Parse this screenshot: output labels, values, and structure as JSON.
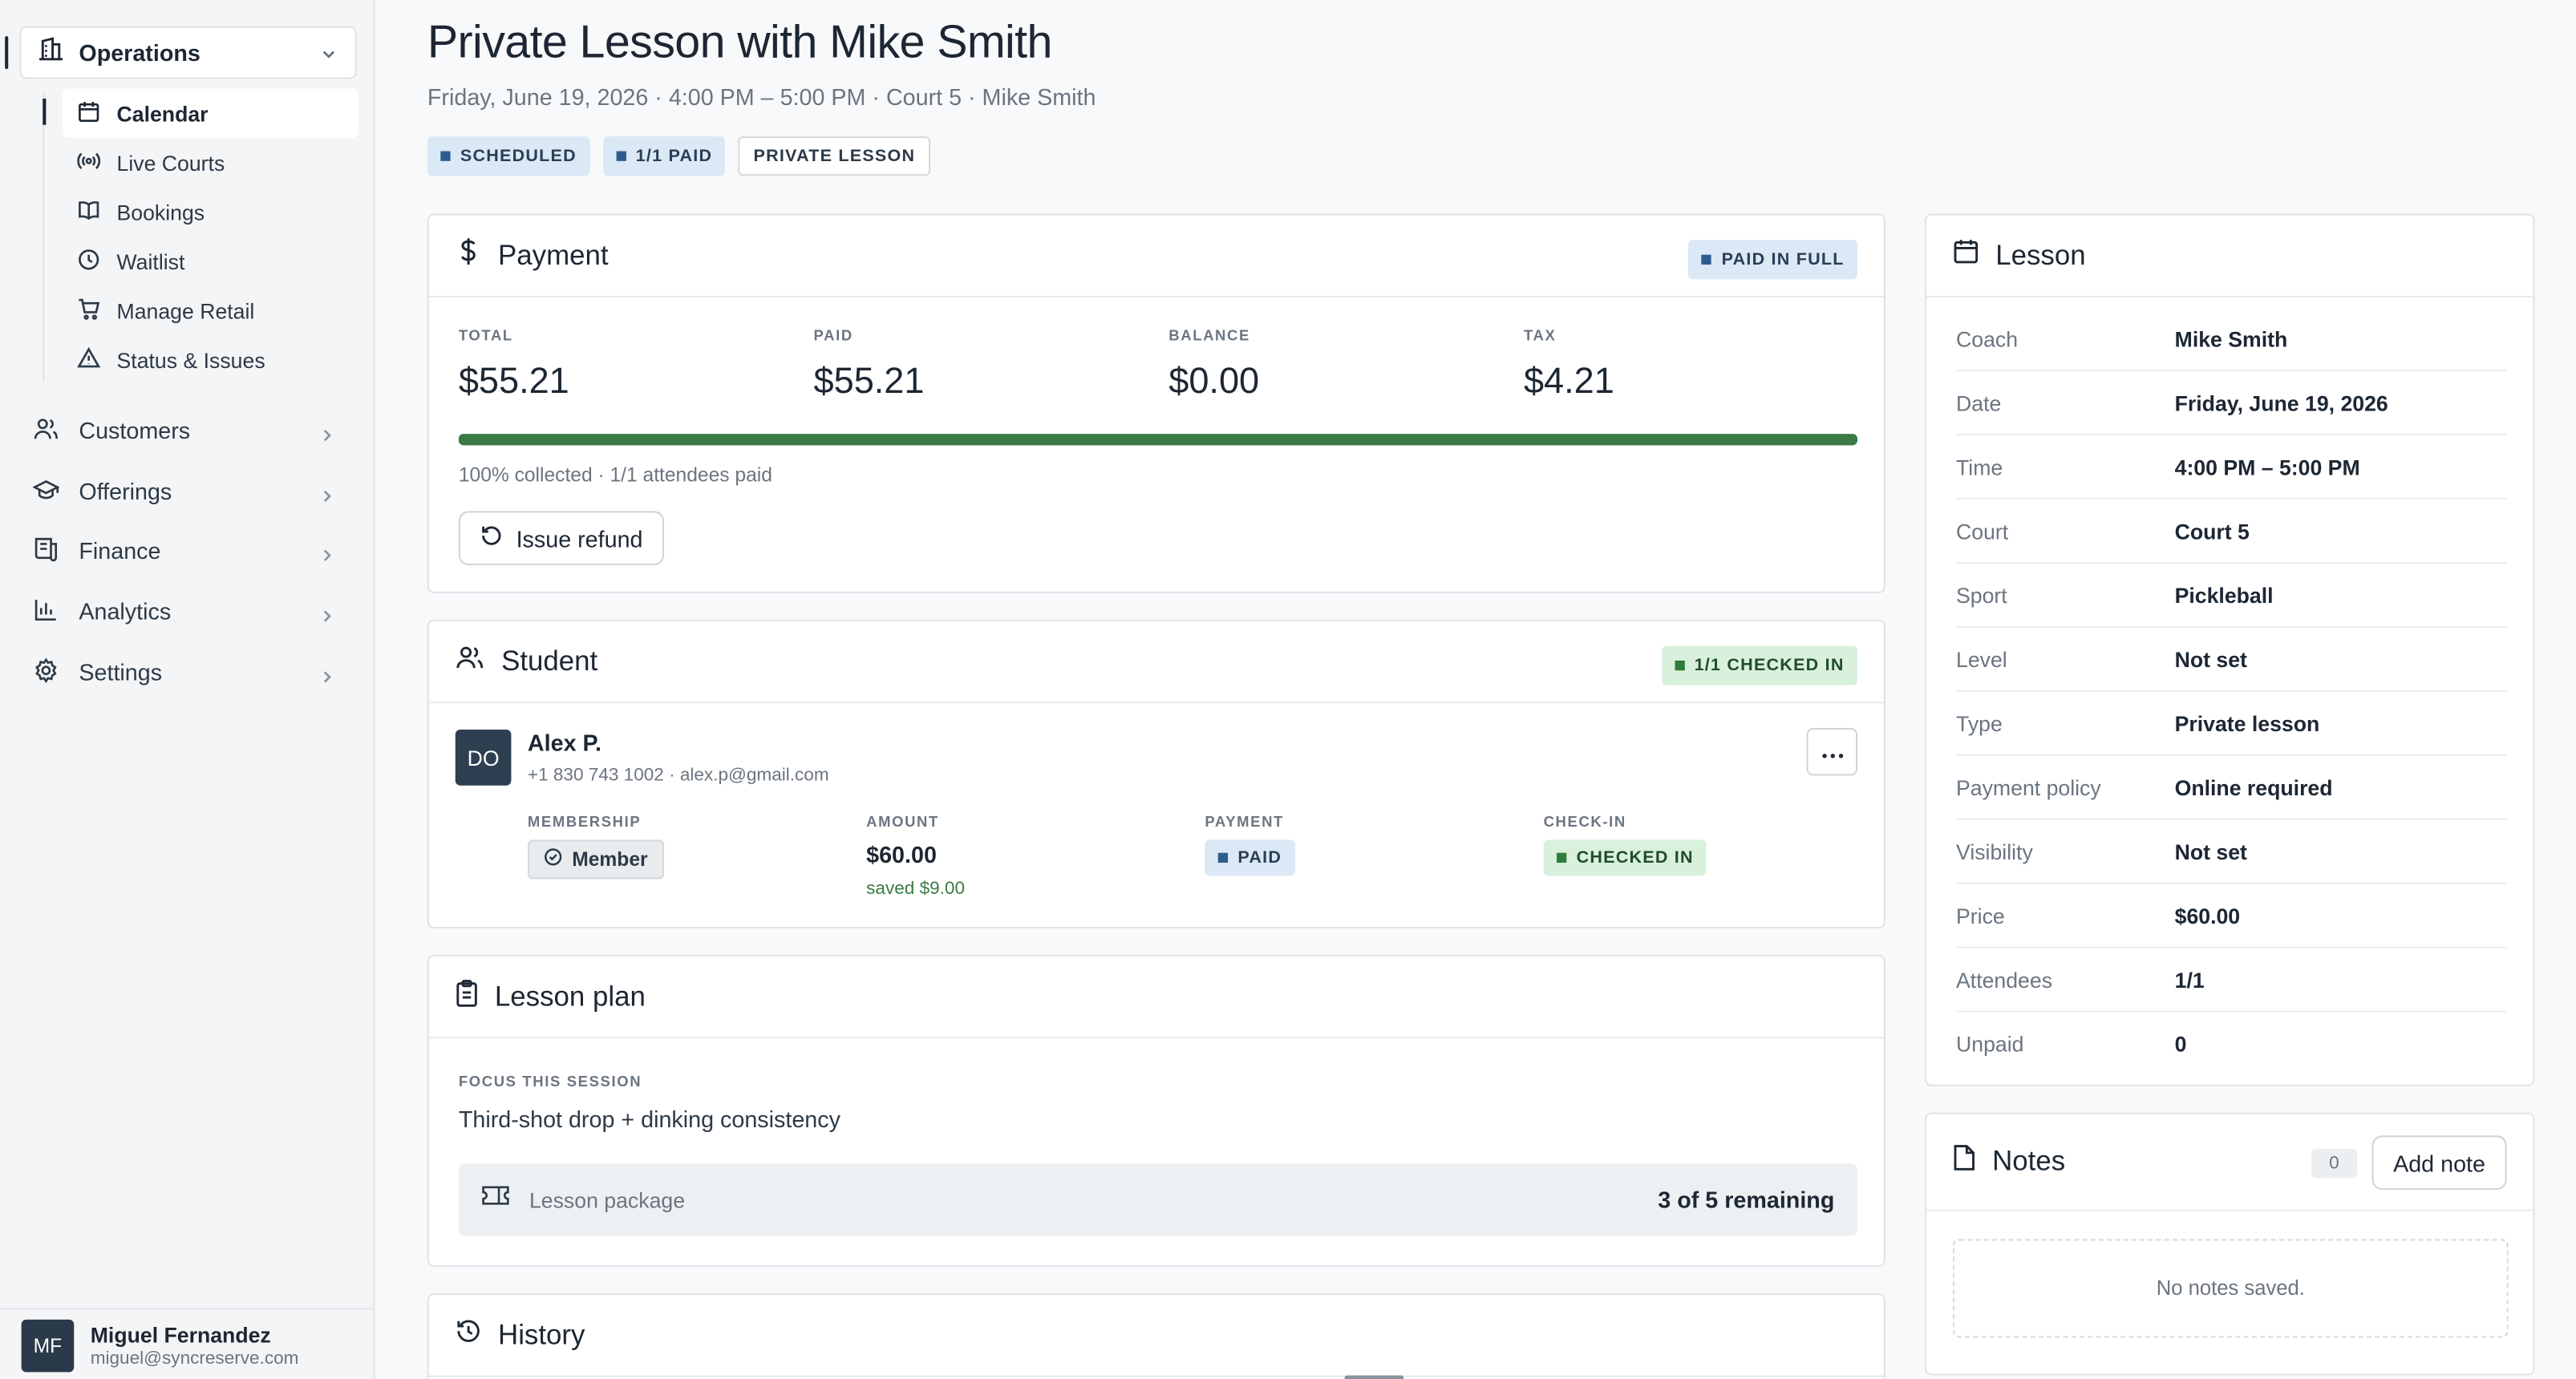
{
  "sidebar": {
    "operations": {
      "label": "Operations"
    },
    "sub_items": [
      {
        "label": "Calendar",
        "icon": "calendar-icon",
        "active": true
      },
      {
        "label": "Live Courts",
        "icon": "broadcast-icon"
      },
      {
        "label": "Bookings",
        "icon": "book-icon"
      },
      {
        "label": "Waitlist",
        "icon": "clock-icon"
      },
      {
        "label": "Manage Retail",
        "icon": "cart-icon"
      },
      {
        "label": "Status & Issues",
        "icon": "warning-icon"
      }
    ],
    "groups": [
      {
        "label": "Customers",
        "icon": "users-icon"
      },
      {
        "label": "Offerings",
        "icon": "graduation-cap-icon"
      },
      {
        "label": "Finance",
        "icon": "ledger-icon"
      },
      {
        "label": "Analytics",
        "icon": "bar-chart-icon"
      },
      {
        "label": "Settings",
        "icon": "gear-icon"
      }
    ],
    "user": {
      "initials": "MF",
      "name": "Miguel Fernandez",
      "email": "miguel@syncreserve.com"
    }
  },
  "header": {
    "title": "Private Lesson with Mike Smith",
    "subtitle": "Friday, June 19, 2026 · 4:00 PM – 5:00 PM · Court 5 · Mike Smith",
    "badges": [
      "SCHEDULED",
      "1/1 PAID",
      "PRIVATE LESSON"
    ]
  },
  "payment": {
    "title": "Payment",
    "status": "PAID IN FULL",
    "stats": [
      {
        "label": "TOTAL",
        "value": "$55.21"
      },
      {
        "label": "PAID",
        "value": "$55.21"
      },
      {
        "label": "BALANCE",
        "value": "$0.00"
      },
      {
        "label": "TAX",
        "value": "$4.21"
      }
    ],
    "collected_fraction": 1.0,
    "summary": "100% collected · 1/1 attendees paid",
    "refund_label": "Issue refund"
  },
  "student": {
    "title": "Student",
    "status": "1/1 CHECKED IN",
    "initials": "DO",
    "name": "Alex P.",
    "contact": "+1 830 743 1002 · alex.p@gmail.com",
    "membership_label": "MEMBERSHIP",
    "membership": "Member",
    "amount_label": "AMOUNT",
    "amount": "$60.00",
    "saved": "saved $9.00",
    "payment_label": "PAYMENT",
    "payment": "PAID",
    "checkin_label": "CHECK-IN",
    "checkin": "CHECKED IN"
  },
  "lesson_plan": {
    "title": "Lesson plan",
    "focus_label": "FOCUS THIS SESSION",
    "focus": "Third-shot drop + dinking consistency",
    "package_label": "Lesson package",
    "package_remaining": "3 of 5 remaining"
  },
  "history": {
    "title": "History"
  },
  "lesson": {
    "title": "Lesson",
    "rows": [
      {
        "k": "Coach",
        "v": "Mike Smith"
      },
      {
        "k": "Date",
        "v": "Friday, June 19, 2026"
      },
      {
        "k": "Time",
        "v": "4:00 PM – 5:00 PM"
      },
      {
        "k": "Court",
        "v": "Court 5"
      },
      {
        "k": "Sport",
        "v": "Pickleball"
      },
      {
        "k": "Level",
        "v": "Not set"
      },
      {
        "k": "Type",
        "v": "Private lesson"
      },
      {
        "k": "Payment policy",
        "v": "Online required"
      },
      {
        "k": "Visibility",
        "v": "Not set"
      },
      {
        "k": "Price",
        "v": "$60.00"
      },
      {
        "k": "Attendees",
        "v": "1/1"
      },
      {
        "k": "Unpaid",
        "v": "0"
      }
    ]
  },
  "notes": {
    "title": "Notes",
    "count": "0",
    "add_label": "Add note",
    "empty": "No notes saved."
  }
}
